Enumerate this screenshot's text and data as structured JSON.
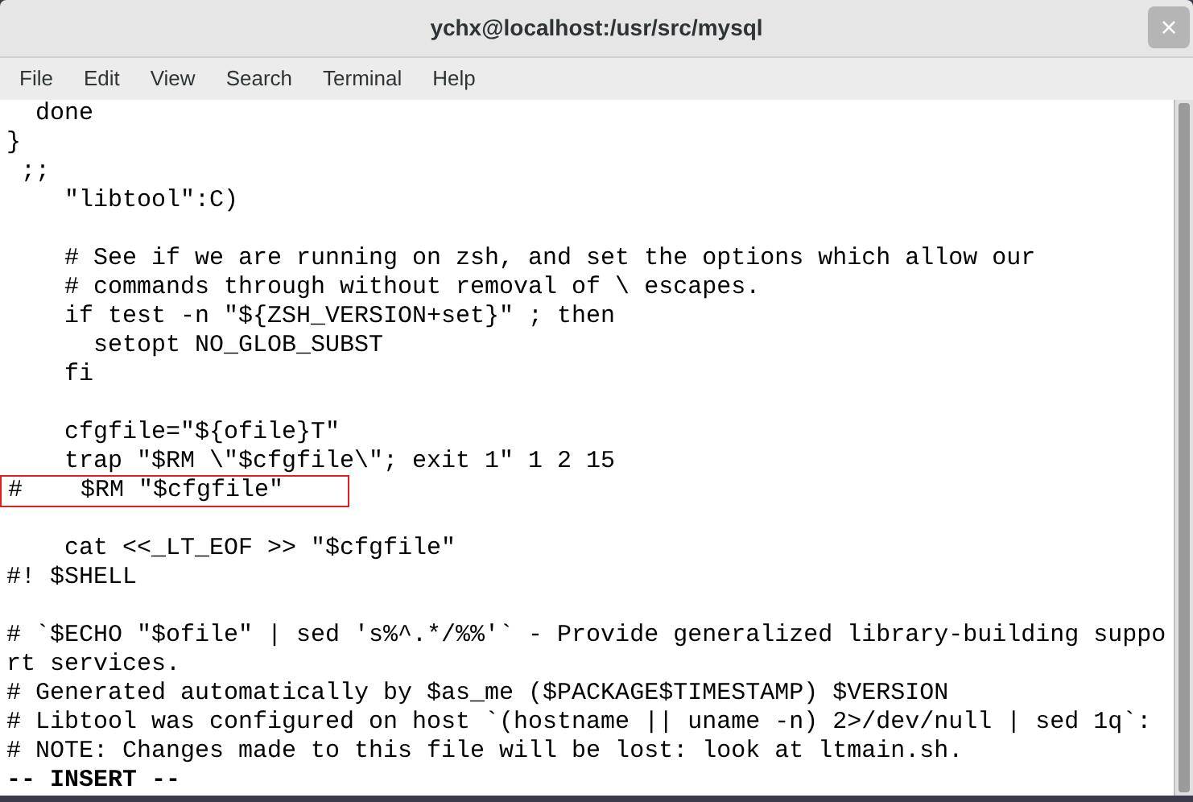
{
  "window": {
    "title": "ychx@localhost:/usr/src/mysql",
    "close": "×"
  },
  "menu": [
    "File",
    "Edit",
    "View",
    "Search",
    "Terminal",
    "Help"
  ],
  "lines": [
    {
      "text": "  done",
      "highlighted": false
    },
    {
      "text": "}",
      "highlighted": false
    },
    {
      "text": " ;;",
      "highlighted": false
    },
    {
      "text": "    \"libtool\":C)",
      "highlighted": false
    },
    {
      "highlighted": false
    },
    {
      "text": "    # See if we are running on zsh, and set the options which allow our",
      "highlighted": false
    },
    {
      "text": "    # commands through without removal of \\ escapes.",
      "highlighted": false
    },
    {
      "text": "    if test -n \"${ZSH_VERSION+set}\" ; then",
      "highlighted": false
    },
    {
      "text": "      setopt NO_GLOB_SUBST",
      "highlighted": false
    },
    {
      "text": "    fi",
      "highlighted": false
    },
    {
      "highlighted": false
    },
    {
      "text": "    cfgfile=\"${ofile}T\"",
      "highlighted": false
    },
    {
      "text": "    trap \"$RM \\\"$cfgfile\\\"; exit 1\" 1 2 15",
      "highlighted": false
    },
    {
      "text": "#    $RM \"$cfgfile\"",
      "highlighted": true
    },
    {
      "highlighted": false
    },
    {
      "text": "    cat <<_LT_EOF >> \"$cfgfile\"",
      "highlighted": false
    },
    {
      "text": "#! $SHELL",
      "highlighted": false
    },
    {
      "highlighted": false
    },
    {
      "text": "# `$ECHO \"$ofile\" | sed 's%^.*/%%'` - Provide generalized library-building suppo",
      "highlighted": false
    },
    {
      "text": "rt services.",
      "highlighted": false
    },
    {
      "text": "# Generated automatically by $as_me ($PACKAGE$TIMESTAMP) $VERSION",
      "highlighted": false
    },
    {
      "text": "# Libtool was configured on host `(hostname || uname -n) 2>/dev/null | sed 1q`:",
      "highlighted": false
    },
    {
      "text": "# NOTE: Changes made to this file will be lost: look at ltmain.sh.",
      "highlighted": false
    }
  ],
  "status_line": "-- INSERT --"
}
